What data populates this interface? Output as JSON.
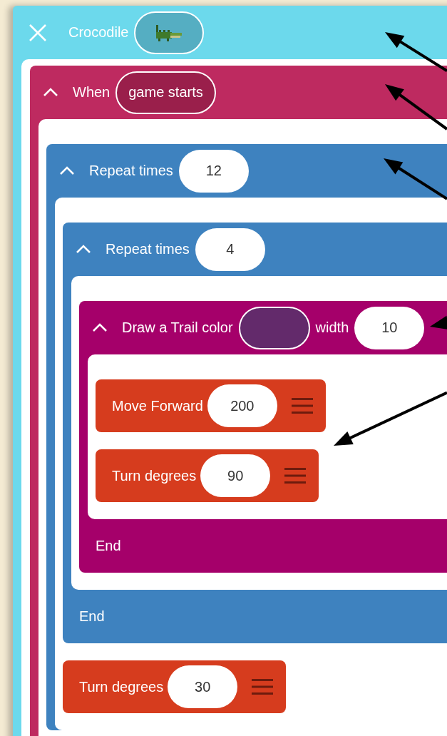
{
  "sprite": {
    "name": "Crocodile",
    "blocks": [
      {
        "kind": "event",
        "label": "When",
        "event": "game starts",
        "expanded": true,
        "children": [
          {
            "kind": "repeat",
            "label": "Repeat times",
            "value": "12",
            "expanded": true,
            "children": [
              {
                "kind": "repeat",
                "label": "Repeat times",
                "value": "4",
                "expanded": true,
                "end_label": "End",
                "children": [
                  {
                    "kind": "trail",
                    "label": "Draw a Trail color",
                    "color": "#632a6b",
                    "width_label": "width",
                    "value": "10",
                    "expanded": true,
                    "end_label": "End",
                    "children": [
                      {
                        "kind": "action",
                        "label": "Move Forward",
                        "value": "200"
                      },
                      {
                        "kind": "action",
                        "label": "Turn degrees",
                        "value": "90"
                      }
                    ]
                  }
                ]
              },
              {
                "kind": "action",
                "label": "Turn degrees",
                "value": "30"
              }
            ]
          }
        ]
      }
    ]
  }
}
